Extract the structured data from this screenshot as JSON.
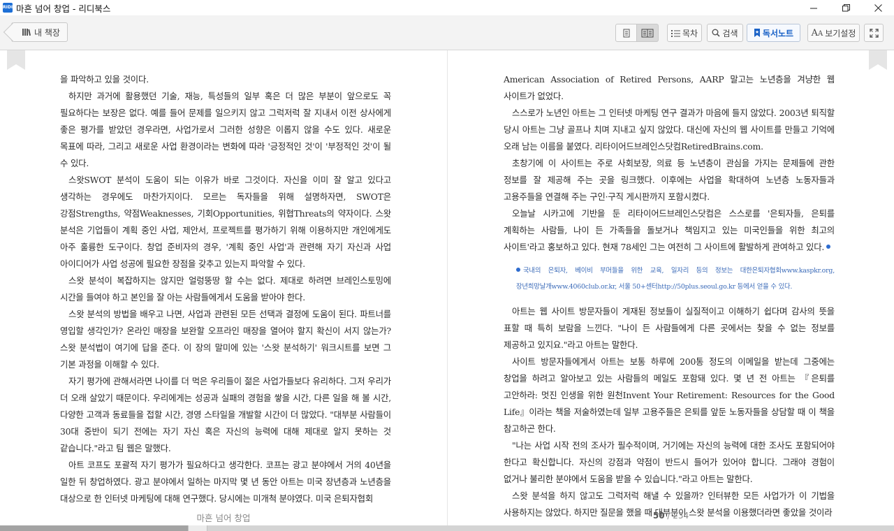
{
  "window": {
    "app_icon_text": "RIDI",
    "title": "마흔 넘어 창업 - 리디북스",
    "controls": [
      "minimize-icon",
      "restore-icon",
      "close-icon"
    ]
  },
  "toolbar": {
    "back_label": "내 책장",
    "toc_label": "목차",
    "search_label": "검색",
    "notes_label": "독서노트",
    "view_settings_label": "보기설정",
    "accent_color": "#1a62c7"
  },
  "left_page": {
    "paragraphs": [
      "을 파악하고 있을 것이다.",
      "하지만 과거에 활용했던 기술, 재능, 특성들의 일부 혹은 더 많은 부분이 앞으로도 꼭 필요하다는 보장은 없다. 예를 들어 문제를 일으키지 않고 그럭저럭 잘 지내서 이전 상사에게 좋은 평가를 받았던 경우라면, 사업가로서 그러한 성향은 이롭지 않을 수도 있다. 새로운 목표에 따라, 그리고 새로운 사업 환경이라는 변화에 따라 '긍정적인 것'이 '부정적인 것'이 될 수 있다.",
      "스왓SWOT 분석이 도움이 되는 이유가 바로 그것이다. 자신을 이미 잘 알고 있다고 생각하는 경우에도 마찬가지이다. 모르는 독자들을 위해 설명하자면, SWOT은 강점Strengths, 약점Weaknesses, 기회Opportunities, 위협Threats의 약자이다. 스왓 분석은 기업들이 계획 중인 사업, 제안서, 프로젝트를 평가하기 위해 이용하지만 개인에게도 아주 훌륭한 도구이다. 창업 준비자의 경우, '계획 중인 사업'과 관련해 자기 자신과 사업 아이디어가 사업 성공에 필요한 장점을 갖추고 있는지 파악할 수 있다.",
      "스왓 분석이 복잡하지는 않지만 얼렁뚱땅 할 수는 없다. 제대로 하려면 브레인스토밍에 시간을 들여야 하고 본인을 잘 아는 사람들에게서 도움을 받아야 한다.",
      "스왓 분석의 방법을 배우고 나면, 사업과 관련된 모든 선택과 결정에 도움이 된다. 파트너를 영입할 생각인가? 온라인 매장을 보완할 오프라인 매장을 열어야 할지 확신이 서지 않는가? 스왓 분석법이 여기에 답을 준다. 이 장의 말미에 있는 '스왓 분석하기' 워크시트를 보면 그 기본 과정을 이해할 수 있다.",
      "자기 평가에 관해서라면 나이를 더 먹은 우리들이 젊은 사업가들보다 유리하다. 그저 우리가 더 오래 살았기 때문이다. 우리에게는 성공과 실패의 경험을 쌓을 시간, 다른 일을 해 볼 시간, 다양한 고객과 동료들을 접할 시간, 경영 스타일을 개발할 시간이 더 많았다. \"대부분 사람들이 30대 중반이 되기 전에는 자기 자신 혹은 자신의 능력에 대해 제대로 알지 못하는 것 같습니다.\"라고 팀 웹은 말했다.",
      "아트 코프도 포괄적 자기 평가가 필요하다고 생각한다. 코프는 광고 분야에서 거의 40년을 일한 뒤 창업하였다. 광고 분야에서 일하는 마지막 몇 년 동안 아트는 미국 장년층과 노년층을 대상으로 한 인터넷 마케팅에 대해 연구했다. 당시에는 미개척 분야였다. 미국 은퇴자협회"
    ],
    "footer_title": "마흔 넘어 창업"
  },
  "right_page": {
    "paragraphs_before_note": [
      "American Association of Retired Persons, AARP 말고는 노년층을 겨냥한 웹 사이트가 없었다.",
      "스스로가 노년인 아트는 그 인터넷 마케팅 연구 결과가 마음에 들지 않았다. 2003년 퇴직할 당시 아트는 그냥 골프나 치며 지내고 싶지 않았다. 대신에 자신의 웹 사이트를 만들고 기억에 오래 남는 이름을 붙였다. 리타이어드브레인스닷컴RetiredBrains.com.",
      "초창기에 이 사이트는 주로 사회보장, 의료 등 노년층이 관심을 가지는 문제들에 관한 정보를 잘 제공해 주는 곳을 링크했다. 이후에는 사업을 확대하여 노년층 노동자들과 고용주들을 연결해 주는 구인·구직 게시판까지 포함시켰다.",
      "오늘날 시카고에 기반을 둔 리타이어드브레인스닷컴은 스스로를 '은퇴자들, 은퇴를 계획하는 사람들, 나이 든 가족들을 돌보거나 책임지고 있는 미국인들을 위한 최고의 사이트'라고 홍보하고 있다. 현재 78세인 그는 여전히 그 사이트에 활발하게 관여하고 있다."
    ],
    "footnote": "국내의 은퇴자, 베이비 부머들을 위한 교육, 일자리 등의 정보는 대한은퇴자협회www.kaspkr.org, 장년희망날개www.4060club.or.kr, 서울 50+센터http://50plus.seoul.go.kr 등에서 얻을 수 있다.",
    "paragraphs_after_note": [
      "아트는 웹 사이트 방문자들이 게재된 정보들이 실질적이고 이해하기 쉽다며 감사의 뜻을 표할 때 특히 보람을 느낀다. \"나이 든 사람들에게 다른 곳에서는 찾을 수 없는 정보를 제공하고 있지요.\"라고 아트는 말한다.",
      "사이트 방문자들에게서 아트는 보통 하루에 200통 정도의 이메일을 받는데 그중에는 창업을 하려고 알아보고 있는 사람들의 메일도 포함돼 있다. 몇 년 전 아트는 『은퇴를 고안하라: 멋진 인생을 위한 원천Invent Your Retirement: Resources for the Good Life』이라는 책을 저술하였는데 일부 고용주들은 은퇴를 앞둔 노동자들을 상담할 때 이 책을 참고하곤 한다.",
      "\"나는 사업 시작 전의 조사가 필수적이며, 거기에는 자신의 능력에 대한 조사도 포함되어야 한다고 확신합니다. 자신의 강점과 약점이 반드시 들어가 있어야 합니다. 그래야 경험이 없거나 불리한 분야에서 도움을 받을 수 있습니다.\"라고 아트는 말한다.",
      "스왓 분석을 하지 않고도 그럭저럭 해낼 수 있을까? 인터뷰한 모든 사업가가 이 기법을 사용하지는 않았다. 하지만 질문을 했을 때 대부분이 스왓 분석을 이용했더라면 좋았을 것이라"
    ],
    "footer_current_page": "50",
    "footer_total_pages": "/ 234"
  },
  "progress": {
    "fraction": 0.21
  }
}
